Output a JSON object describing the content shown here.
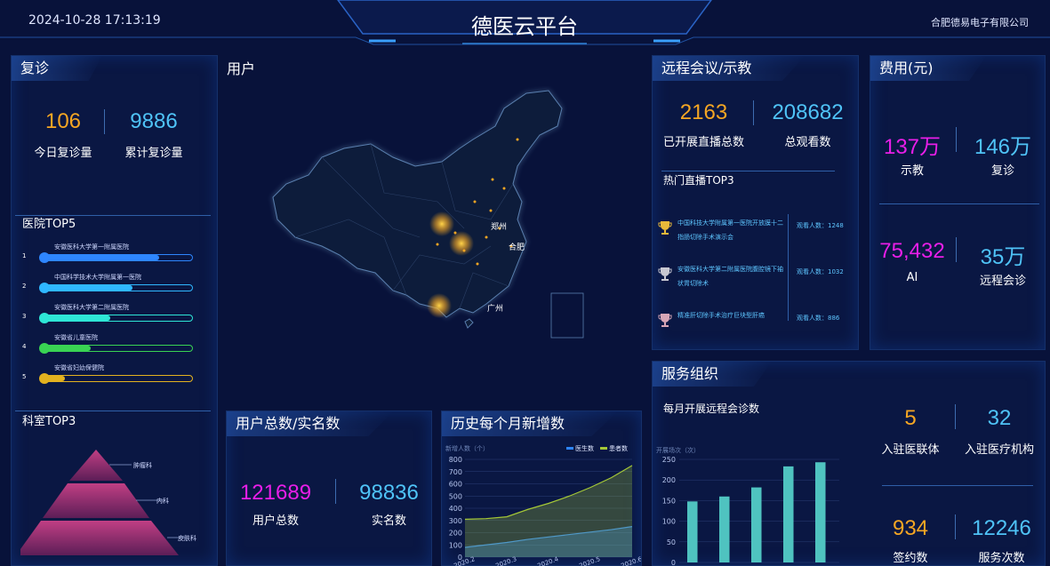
{
  "header": {
    "datetime": "2024-10-28 17:13:19",
    "title": "德医云平台",
    "company": "合肥德易电子有限公司"
  },
  "revisit": {
    "title": "复诊",
    "stats": [
      {
        "value": "106",
        "label": "今日复诊量",
        "color": "#f5a623"
      },
      {
        "value": "9886",
        "label": "累计复诊量",
        "color": "#4fc3f7"
      }
    ],
    "hospital_title": "医院TOP5",
    "hospitals": [
      {
        "rank": "1",
        "name": "安徽医科大学第一附属医院",
        "fill": 0.78,
        "color": "#2e86ff"
      },
      {
        "rank": "2",
        "name": "中国科学技术大学附属第一医院",
        "fill": 0.6,
        "color": "#2fb7ff"
      },
      {
        "rank": "3",
        "name": "安徽医科大学第二附属医院",
        "fill": 0.45,
        "color": "#2ee6d6"
      },
      {
        "rank": "4",
        "name": "安徽省儿童医院",
        "fill": 0.32,
        "color": "#39d353"
      },
      {
        "rank": "5",
        "name": "安徽省妇幼保健院",
        "fill": 0.15,
        "color": "#e3b21f"
      }
    ],
    "dept_title": "科室TOP3",
    "depts": [
      "肿瘤科",
      "内科",
      "皮肤科"
    ]
  },
  "users": {
    "title": "用户",
    "cities": [
      "郑州",
      "合肥",
      "广州"
    ]
  },
  "user_total": {
    "title": "用户总数/实名数",
    "stats": [
      {
        "value": "121689",
        "label": "用户总数",
        "color": "#e91ee8"
      },
      {
        "value": "98836",
        "label": "实名数",
        "color": "#4fc3f7"
      }
    ]
  },
  "history": {
    "title": "历史每个月新增数"
  },
  "chart_data": {
    "type": "area",
    "title": "",
    "ylabel": "新增人数（个）",
    "ylim": [
      0,
      800
    ],
    "yticks": [
      "800",
      "700",
      "600",
      "500",
      "400",
      "300",
      "200",
      "100",
      "0"
    ],
    "categories": [
      "2020.2",
      "2020.3",
      "2020.4",
      "2020.5",
      "2020.6"
    ],
    "x": [
      "2020.2",
      "",
      "2020.3",
      "",
      "2020.4",
      "",
      "2020.5",
      "",
      "2020.6"
    ],
    "series": [
      {
        "name": "医生数",
        "color": "#2e86ff",
        "values": [
          80,
          100,
          120,
          145,
          165,
          185,
          205,
          225,
          250
        ]
      },
      {
        "name": "患者数",
        "color": "#a5c837",
        "values": [
          310,
          315,
          330,
          390,
          440,
          500,
          570,
          650,
          750
        ]
      }
    ]
  },
  "remote": {
    "title": "远程会议/示教",
    "stats": [
      {
        "value": "2163",
        "label": "已开展直播总数",
        "color": "#f5a623"
      },
      {
        "value": "208682",
        "label": "总观看数",
        "color": "#4fc3f7"
      }
    ],
    "hot_title": "热门直播TOP3",
    "hot": [
      {
        "title": "中国科技大学附属第一医院开放膜十二指肠切除手术演示会",
        "viewers": "观看人数：1248",
        "trophy": "#e8b83a"
      },
      {
        "title": "安徽医科大学第二附属医院腹腔镜下袖状胃切除术",
        "viewers": "观看人数：1032",
        "trophy": "#c7c7d1"
      },
      {
        "title": "精准肝切除手术治疗巨块型肝癌",
        "viewers": "观看人数：886",
        "trophy": "#d7a6b6"
      }
    ]
  },
  "fees": {
    "title": "费用(元)",
    "stats": [
      {
        "value": "137万",
        "label": "示教",
        "color": "#e91ee8"
      },
      {
        "value": "146万",
        "label": "复诊",
        "color": "#4fc3f7"
      },
      {
        "value": "75,432",
        "label": "AI",
        "color": "#e91ee8"
      },
      {
        "value": "35万",
        "label": "远程会诊",
        "color": "#4fc3f7"
      }
    ]
  },
  "service": {
    "title": "服务组织",
    "subtitle": "每月开展远程会诊数",
    "bar_chart": {
      "ylabel": "开展场次（次）",
      "ylim": [
        0,
        250
      ],
      "yticks": [
        "250",
        "200",
        "150",
        "100",
        "50",
        "0"
      ],
      "values": [
        148,
        160,
        182,
        233,
        243
      ]
    },
    "stats": [
      {
        "value": "5",
        "label": "入驻医联体",
        "color": "#f5a623"
      },
      {
        "value": "32",
        "label": "入驻医疗机构",
        "color": "#4fc3f7"
      },
      {
        "value": "934",
        "label": "签约数",
        "color": "#f5a623"
      },
      {
        "value": "12246",
        "label": "服务次数",
        "color": "#4fc3f7"
      }
    ]
  }
}
